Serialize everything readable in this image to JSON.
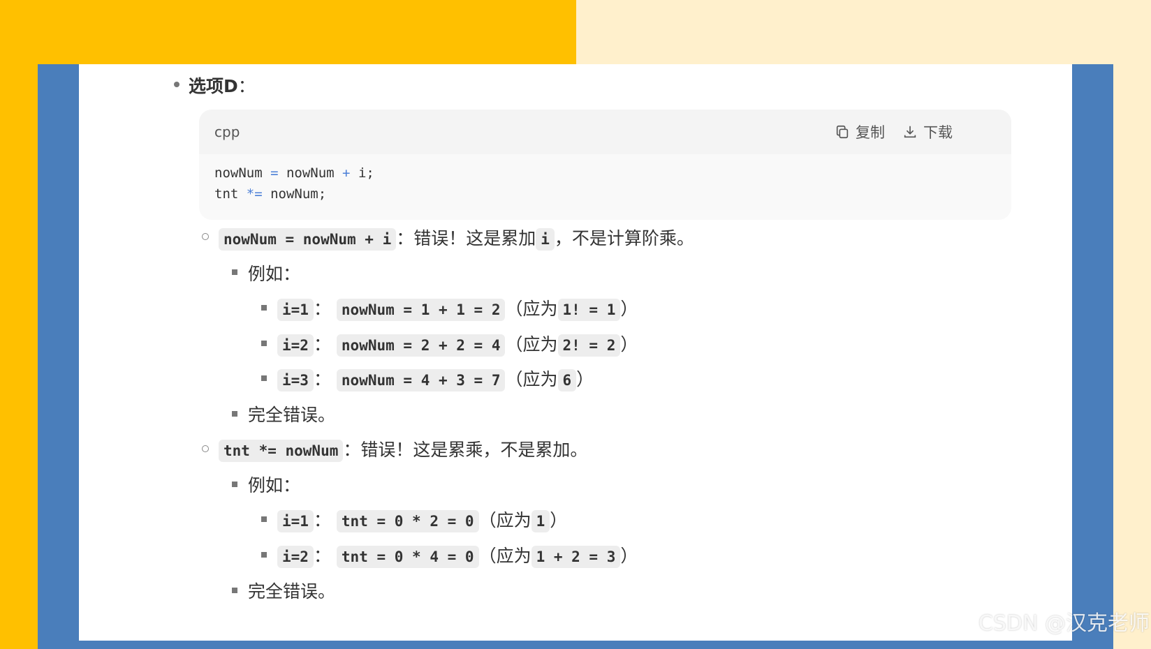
{
  "colors": {
    "left_bg": "#FFC000",
    "right_bg": "#FFF0CC",
    "frame": "#4A7EBB",
    "code_bg": "#F9F9F9",
    "inline_code_bg": "#EDEDED",
    "keyword": "#4B7FD7"
  },
  "option": {
    "label": "选项D",
    "colon": "："
  },
  "codeblock": {
    "language": "cpp",
    "copy_label": "复制",
    "copy_icon": "copy-icon",
    "download_label": "下载",
    "download_icon": "download-icon",
    "lines": [
      [
        "nowNum",
        " = ",
        "nowNum",
        " + ",
        "i;"
      ],
      [
        "tnt",
        " *= ",
        "nowNum;"
      ]
    ]
  },
  "item1": {
    "code": "nowNum = nowNum + i",
    "text_a": "：错误！这是累加",
    "code_i": "i",
    "text_b": "，不是计算阶乘。",
    "example_label": "例如：",
    "examples": [
      {
        "i": "i=1",
        "sep": "：",
        "calc": "nowNum = 1 + 1 = 2",
        "note": "（应为",
        "expect": "1! = 1",
        "close": "）"
      },
      {
        "i": "i=2",
        "sep": "：",
        "calc": "nowNum = 2 + 2 = 4",
        "note": "（应为",
        "expect": "2! = 2",
        "close": "）"
      },
      {
        "i": "i=3",
        "sep": "：",
        "calc": "nowNum = 4 + 3 = 7",
        "note": "（应为",
        "expect": "6",
        "close": "）"
      }
    ],
    "conclusion": "完全错误。"
  },
  "item2": {
    "code": "tnt *= nowNum",
    "text": "：错误！这是累乘，不是累加。",
    "example_label": "例如：",
    "examples": [
      {
        "i": "i=1",
        "sep": "：",
        "calc": "tnt = 0 * 2 = 0",
        "note": "（应为",
        "expect": "1",
        "close": "）"
      },
      {
        "i": "i=2",
        "sep": "：",
        "calc": "tnt = 0 * 4 = 0",
        "note": "（应为",
        "expect": "1 + 2 = 3",
        "close": "）"
      }
    ],
    "conclusion": "完全错误。"
  },
  "watermark": "CSDN @汉克老师"
}
